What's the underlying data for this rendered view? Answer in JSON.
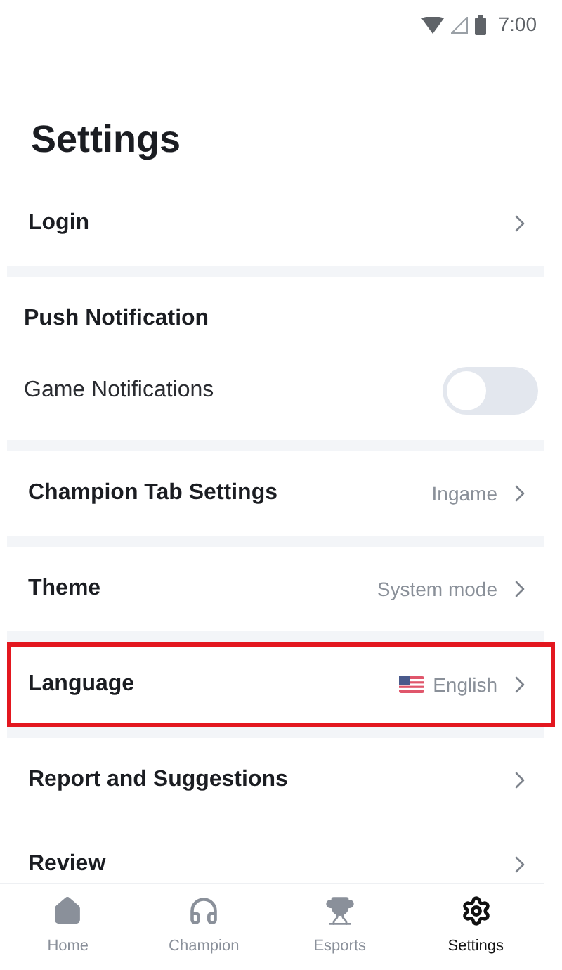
{
  "status_bar": {
    "time": "7:00"
  },
  "title": "Settings",
  "sections": [
    {
      "items": [
        {
          "kind": "link",
          "label": "Login"
        }
      ]
    },
    {
      "items": [
        {
          "kind": "header",
          "label": "Push Notification"
        },
        {
          "kind": "toggle",
          "label": "Game Notifications",
          "on": false
        }
      ]
    },
    {
      "items": [
        {
          "kind": "link",
          "label": "Champion Tab Settings",
          "value": "Ingame"
        }
      ]
    },
    {
      "items": [
        {
          "kind": "link",
          "label": "Theme",
          "value": "System mode"
        }
      ]
    },
    {
      "items": [
        {
          "kind": "link",
          "label": "Language",
          "value": "English",
          "flag": true,
          "highlighted": true
        }
      ]
    },
    {
      "items": [
        {
          "kind": "link",
          "label": "Report and Suggestions"
        },
        {
          "kind": "link",
          "label": "Review"
        }
      ]
    }
  ],
  "bottom_nav": [
    {
      "kind": "home",
      "label": "Home",
      "selected": false
    },
    {
      "kind": "champion",
      "label": "Champion",
      "selected": false
    },
    {
      "kind": "esports",
      "label": "Esports",
      "selected": false
    },
    {
      "kind": "settings",
      "label": "Settings",
      "selected": true
    }
  ]
}
